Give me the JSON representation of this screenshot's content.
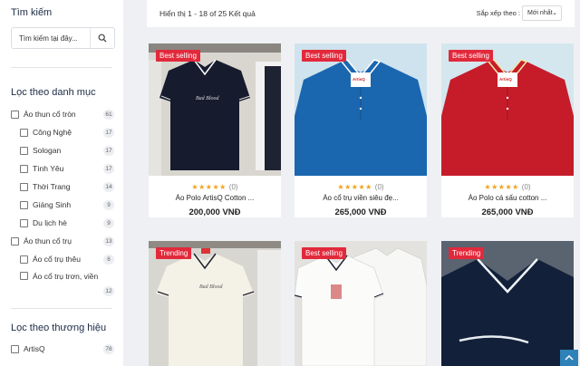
{
  "sidebar": {
    "search_title": "Tìm kiếm",
    "search_placeholder": "Tìm kiếm tại đây...",
    "category_title": "Lọc theo danh mục",
    "categories": [
      {
        "label": "Áo thun cổ tròn",
        "count": "61",
        "sub": false
      },
      {
        "label": "Công Nghệ",
        "count": "17",
        "sub": true
      },
      {
        "label": "Sologan",
        "count": "17",
        "sub": true
      },
      {
        "label": "Tình Yêu",
        "count": "17",
        "sub": true
      },
      {
        "label": "Thời Trang",
        "count": "14",
        "sub": true
      },
      {
        "label": "Giáng Sinh",
        "count": "9",
        "sub": true
      },
      {
        "label": "Du lịch hè",
        "count": "9",
        "sub": true
      },
      {
        "label": "Áo thun cổ trụ",
        "count": "13",
        "sub": false
      },
      {
        "label": "Áo cổ trụ thêu",
        "count": "6",
        "sub": true
      },
      {
        "label": "Áo cổ trụ trơn, viền",
        "count": "12",
        "sub": true
      }
    ],
    "brand_title": "Lọc theo thương hiệu",
    "brands": [
      {
        "label": "ArtisQ",
        "count": "78"
      }
    ]
  },
  "toolbar": {
    "results": "Hiển thị 1 - 18 of 25 Kết quả",
    "sort_label": "Sắp xếp theo :",
    "sort_value": "Mới nhất"
  },
  "products": [
    {
      "badge": "Best selling",
      "stars": "★★★★★",
      "rating_count": "(0)",
      "name": "Áo Polo ArtisQ Cotton ...",
      "price": "200,000 VNĐ"
    },
    {
      "badge": "Best selling",
      "stars": "★★★★★",
      "rating_count": "(0)",
      "name": "Áo cổ trụ viền siêu đẹ...",
      "price": "265,000 VNĐ"
    },
    {
      "badge": "Best selling",
      "stars": "★★★★★",
      "rating_count": "(0)",
      "name": "Áo Polo cá sấu cotton ...",
      "price": "265,000 VNĐ"
    },
    {
      "badge": "Trending"
    },
    {
      "badge": "Best selling"
    },
    {
      "badge": "Trending"
    }
  ],
  "colors": {
    "badge": "#e2293b",
    "star": "#f2a21c",
    "scroll_top": "#2e82b8"
  },
  "icons": {
    "search": "search-icon",
    "chevron": "chevron-down-icon",
    "scroll_top": "arrow-up-icon"
  }
}
